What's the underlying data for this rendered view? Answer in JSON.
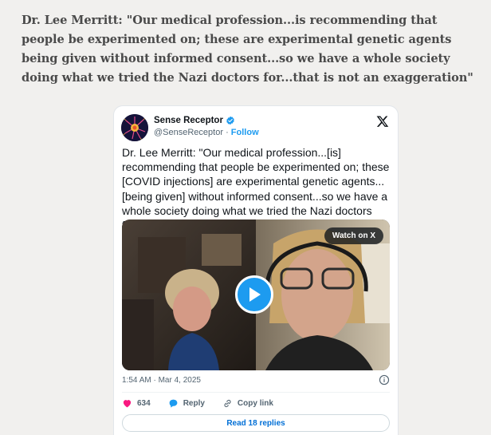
{
  "headline": "Dr. Lee Merritt: \"Our medical profession...is recommending that people be experimented on; these are experimental genetic agents being given without informed consent...so we have a whole society doing what we tried the Nazi doctors for...that is not an exaggeration\"",
  "tweet": {
    "display_name": "Sense Receptor",
    "handle": "@SenseReceptor",
    "separator": "·",
    "follow_label": "Follow",
    "text": "Dr. Lee Merritt: \"Our medical profession...[is] recommending that people be experimented on; these [COVID injections] are experimental genetic agents... [being given] without informed consent...so we have a whole society doing what we tried the Nazi doctors for.\"",
    "video": {
      "watch_label": "Watch on X"
    },
    "timestamp": "1:54 AM · Mar 4, 2025",
    "likes": "634",
    "reply_label": "Reply",
    "copy_link_label": "Copy link",
    "read_replies_label": "Read 18 replies"
  },
  "colors": {
    "accent": "#1d9bf0",
    "like": "#f91880",
    "page_bg": "#f1f0ee"
  }
}
